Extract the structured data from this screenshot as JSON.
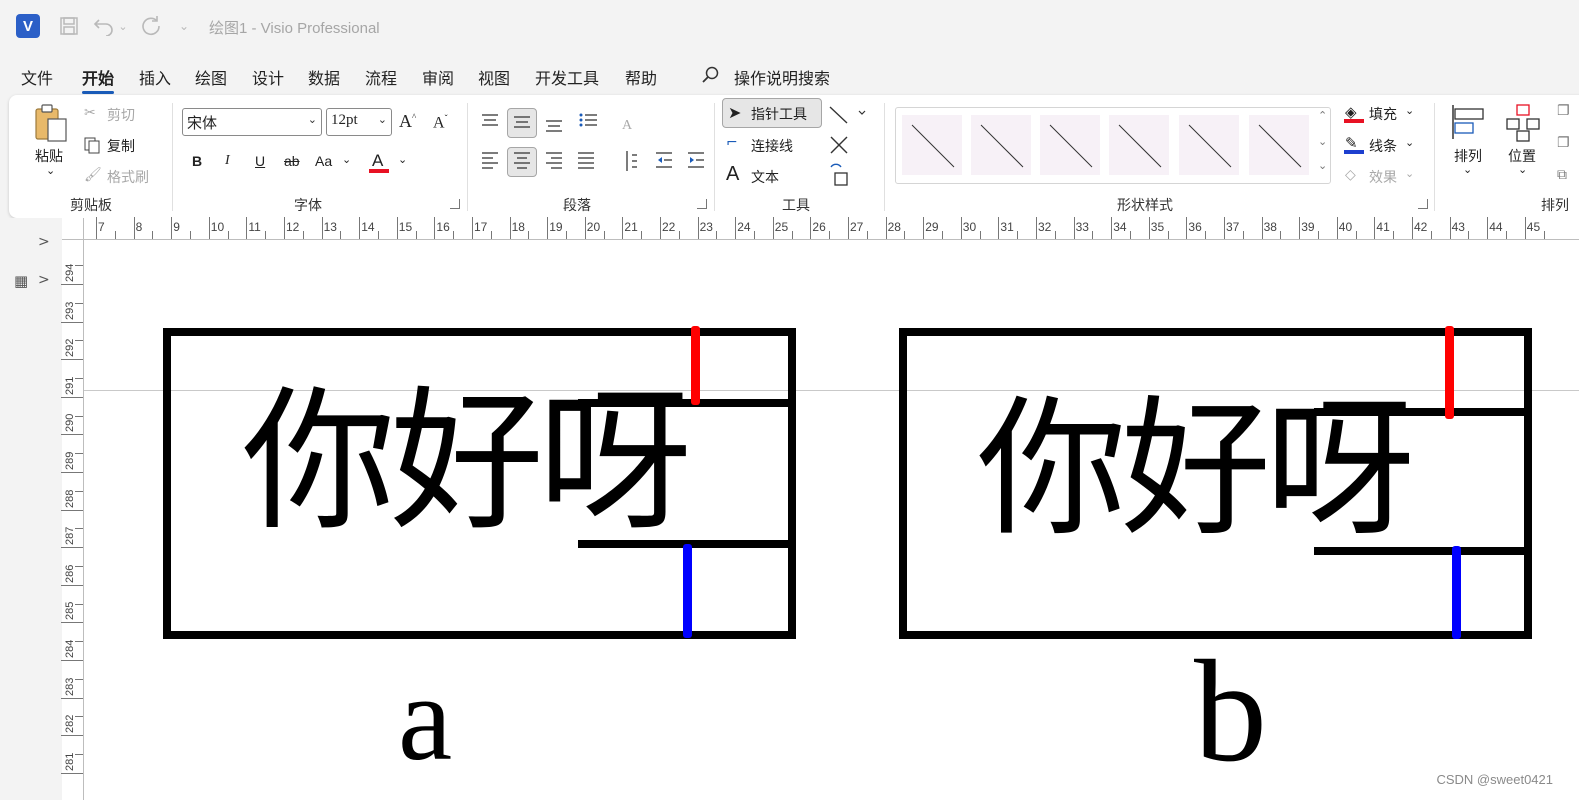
{
  "titlebar": {
    "app_logo_letter": "V",
    "title": "绘图1  -  Visio Professional"
  },
  "tabs": [
    "文件",
    "开始",
    "插入",
    "绘图",
    "设计",
    "数据",
    "流程",
    "审阅",
    "视图",
    "开发工具",
    "帮助"
  ],
  "active_tab": "开始",
  "search_label": "操作说明搜索",
  "ribbon": {
    "clipboard": {
      "paste": "粘贴",
      "cut": "剪切",
      "copy": "复制",
      "format_painter": "格式刷",
      "group_label": "剪贴板"
    },
    "font": {
      "font_name": "宋体",
      "font_size": "12pt",
      "bold": "B",
      "italic": "I",
      "underline": "U",
      "strikethrough": "ab",
      "change_case": "Aa",
      "font_color": "A",
      "group_label": "字体"
    },
    "paragraph": {
      "group_label": "段落"
    },
    "tools": {
      "pointer": "指针工具",
      "connector": "连接线",
      "text": "文本",
      "group_label": "工具"
    },
    "shape_styles": {
      "fill": "填充",
      "line": "线条",
      "effect": "效果",
      "group_label": "形状样式",
      "thumbnail_count": 6
    },
    "arrange": {
      "arrange": "排列",
      "position": "位置",
      "group_label": "排列"
    }
  },
  "ruler_h": [
    "7",
    "8",
    "9",
    "10",
    "11",
    "12",
    "13",
    "14",
    "15",
    "16",
    "17",
    "18",
    "19",
    "20",
    "21",
    "22",
    "23",
    "24",
    "25",
    "26",
    "27",
    "28",
    "29",
    "30",
    "31",
    "32",
    "33",
    "34",
    "35",
    "36",
    "37",
    "38",
    "39",
    "40",
    "41",
    "42",
    "43",
    "44",
    "45"
  ],
  "ruler_v": [
    "294",
    "293",
    "292",
    "291",
    "290",
    "289",
    "288",
    "287",
    "286",
    "285",
    "284",
    "283",
    "282",
    "281"
  ],
  "drawing": {
    "panel_a": {
      "text": "你好呀",
      "caption": "a"
    },
    "panel_b": {
      "text": "你好呀",
      "caption": "b"
    },
    "marker_top_color": "#ff0000",
    "marker_bottom_color": "#0000ff"
  },
  "watermark": "CSDN @sweet0421"
}
